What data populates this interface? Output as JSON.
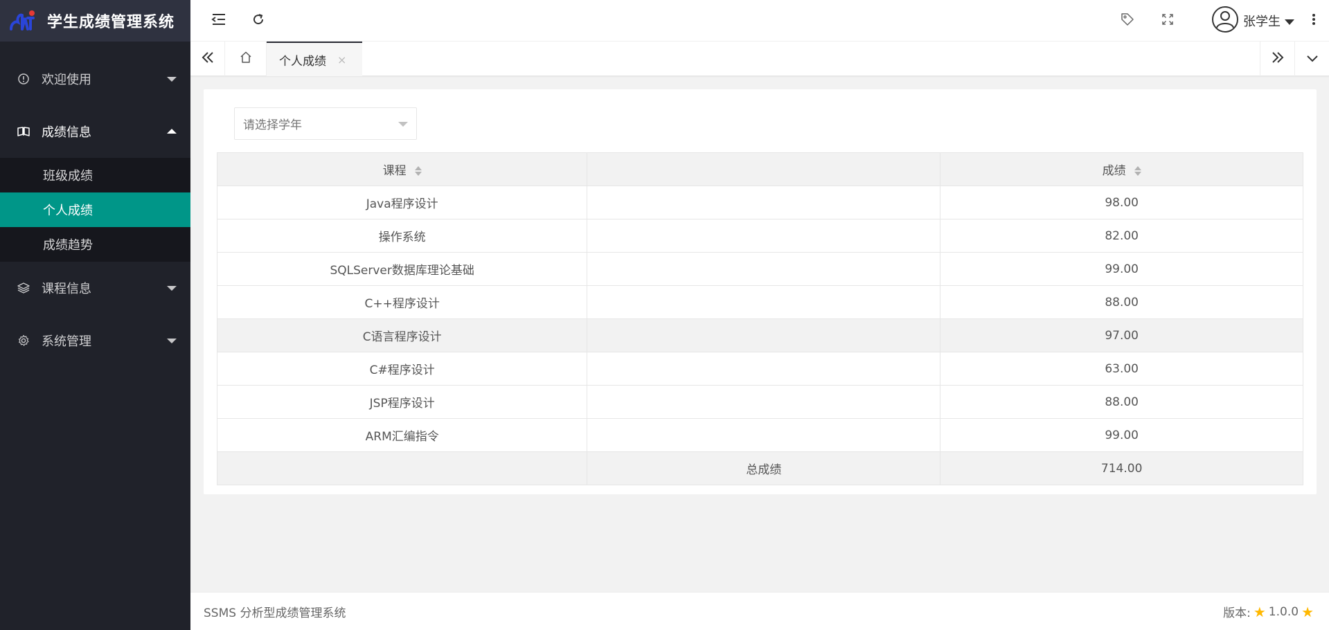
{
  "app": {
    "title": "学生成绩管理系统"
  },
  "sidebar": {
    "items": [
      {
        "label": "欢迎使用",
        "icon": "info-circle-icon",
        "expanded": false
      },
      {
        "label": "成绩信息",
        "icon": "book-icon",
        "expanded": true,
        "children": [
          {
            "label": "班级成绩",
            "active": false
          },
          {
            "label": "个人成绩",
            "active": true
          },
          {
            "label": "成绩趋势",
            "active": false
          }
        ]
      },
      {
        "label": "课程信息",
        "icon": "layers-icon",
        "expanded": false
      },
      {
        "label": "系统管理",
        "icon": "gear-icon",
        "expanded": false
      }
    ]
  },
  "header": {
    "username": "张学生"
  },
  "tabs": {
    "active_label": "个人成绩",
    "close_glyph": "×"
  },
  "filter": {
    "year_placeholder": "请选择学年"
  },
  "table": {
    "columns": [
      "课程",
      "成绩"
    ],
    "rows": [
      {
        "course": "Java程序设计",
        "score": "98.00"
      },
      {
        "course": "操作系统",
        "score": "82.00"
      },
      {
        "course": "SQLServer数据库理论基础",
        "score": "99.00"
      },
      {
        "course": "C++程序设计",
        "score": "88.00"
      },
      {
        "course": "C语言程序设计",
        "score": "97.00"
      },
      {
        "course": "C#程序设计",
        "score": "63.00"
      },
      {
        "course": "JSP程序设计",
        "score": "88.00"
      },
      {
        "course": "ARM汇编指令",
        "score": "99.00"
      }
    ],
    "total_label": "总成绩",
    "total_value": "714.00"
  },
  "footer": {
    "left_text": "SSMS 分析型成绩管理系统",
    "version_label": "版本:",
    "version_value": "1.0.0"
  },
  "colors": {
    "sidebar_bg": "#20222a",
    "logo_bg": "#2f3240",
    "active": "#009688",
    "star": "#ffb800"
  }
}
